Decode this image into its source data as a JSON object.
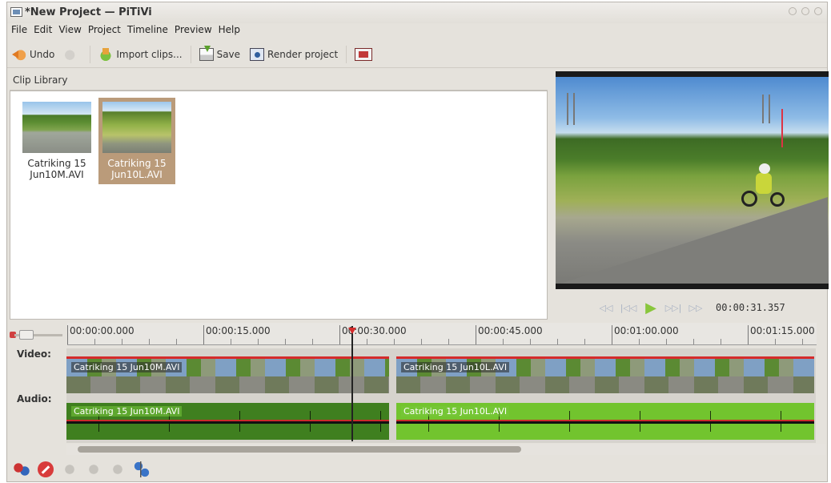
{
  "window": {
    "title": "*New Project — PiTiVi"
  },
  "menubar": {
    "items": [
      "File",
      "Edit",
      "View",
      "Project",
      "Timeline",
      "Preview",
      "Help"
    ]
  },
  "toolbar": {
    "undo_label": "Undo",
    "import_label": "Import clips...",
    "save_label": "Save",
    "render_label": "Render project"
  },
  "clip_library": {
    "title": "Clip Library",
    "clips": [
      {
        "name_line1": "Catriking 15",
        "name_line2": "Jun10M.AVI",
        "selected": false
      },
      {
        "name_line1": "Catriking 15",
        "name_line2": "Jun10L.AVI",
        "selected": true
      }
    ]
  },
  "viewer": {
    "timecode": "00:00:31.357"
  },
  "timeline": {
    "ruler_labels": [
      "00:00:00.000",
      "00:00:15.000",
      "00:00:30.000",
      "00:00:45.000",
      "00:01:00.000",
      "00:01:15.000"
    ],
    "video_track_label": "Video:",
    "audio_track_label": "Audio:",
    "video_clips": [
      "Catriking 15 Jun10M.AVI",
      "Catriking 15 Jun10L.AVI"
    ],
    "audio_clips": [
      "Catriking 15 Jun10M.AVI",
      "Catriking 15 Jun10L.AVI"
    ],
    "playhead_time": "00:00:31.357"
  },
  "icons": {
    "undo": "undo-icon",
    "redo": "redo-icon",
    "import": "import-icon",
    "save": "save-icon",
    "render": "render-icon",
    "fullscreen": "fullscreen-icon",
    "split": "split-icon",
    "delete": "delete-icon",
    "link": "link-icon",
    "unlink": "unlink-icon",
    "group": "group-icon",
    "ungroup": "ungroup-icon",
    "align": "align-icon"
  },
  "colors": {
    "selection": "#ba9b7a",
    "audio_clip_a": "#3f7f1f",
    "audio_clip_b": "#72c42e",
    "playhead": "#d52b2b"
  }
}
